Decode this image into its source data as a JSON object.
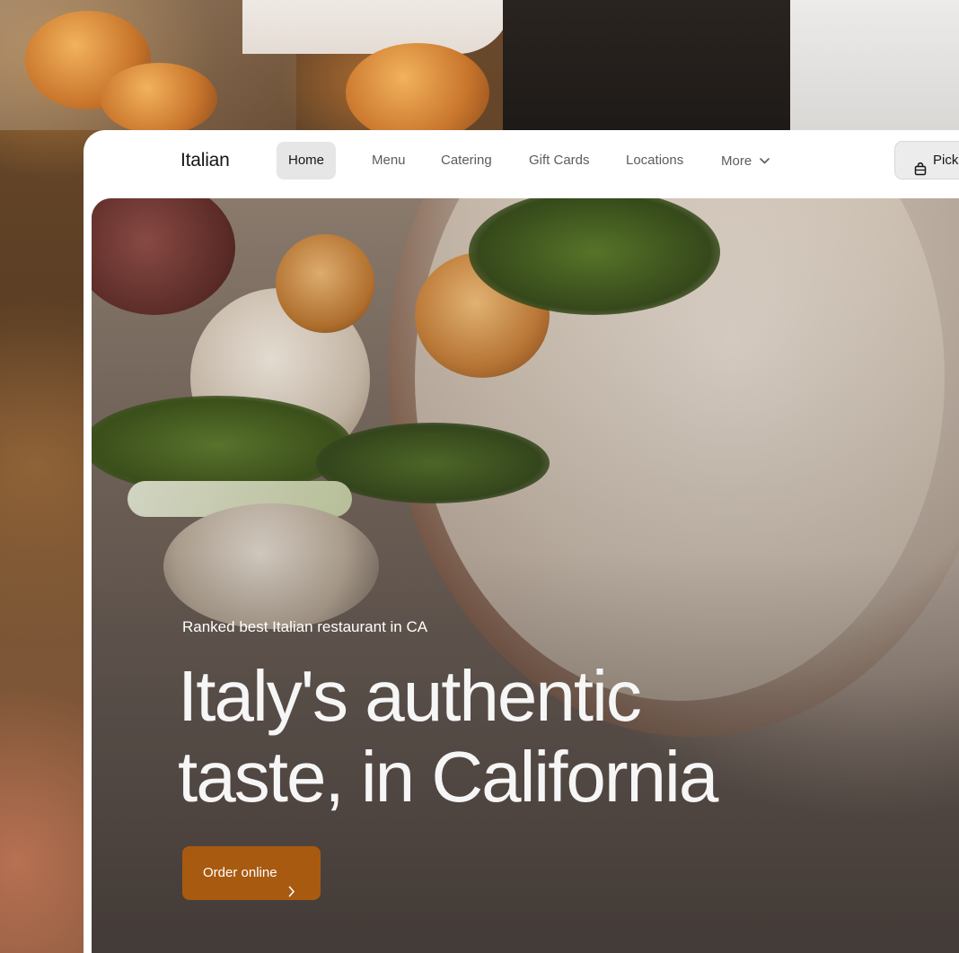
{
  "brand": "Italian",
  "nav": {
    "items": [
      "Home",
      "Menu",
      "Catering",
      "Gift Cards",
      "Locations",
      "More"
    ],
    "active": "Home",
    "pickup_label": "Pick"
  },
  "hero": {
    "kicker": "Ranked best Italian restaurant in CA",
    "headline_line1": "Italy's authentic",
    "headline_line2": "taste, in California",
    "cta_label": "Order online"
  },
  "colors": {
    "accent": "#a85a10",
    "nav_active_bg": "#e6e6e6",
    "text_dark": "#161616",
    "text_muted": "#5c5c5c"
  },
  "icons": {
    "more": "chevron-down-icon",
    "pickup": "shopping-bag-icon",
    "cta": "chevron-right-icon"
  }
}
